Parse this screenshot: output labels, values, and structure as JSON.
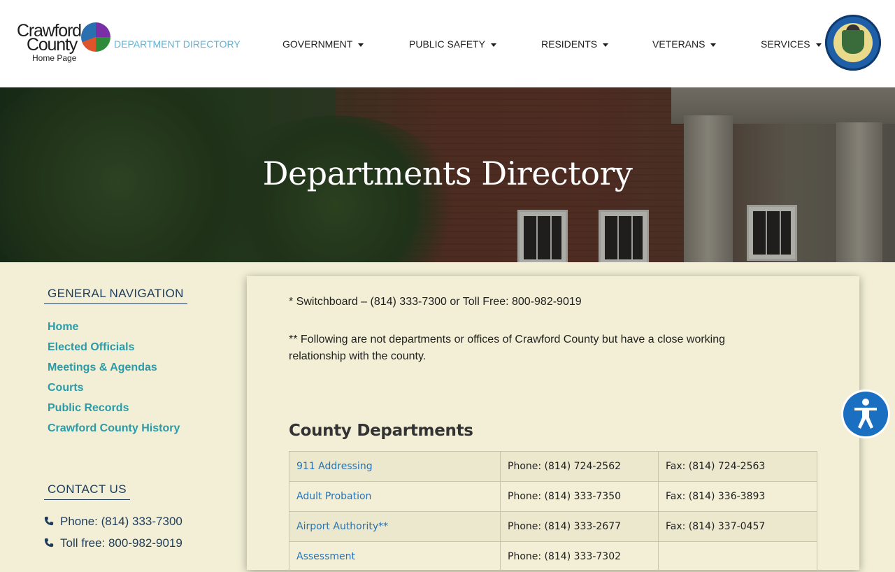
{
  "header": {
    "logo": {
      "line1": "Crawford",
      "line2": "County",
      "line3": "Home Page"
    },
    "nav": [
      {
        "label": "DEPARTMENT DIRECTORY",
        "active": true,
        "dropdown": false
      },
      {
        "label": "GOVERNMENT",
        "active": false,
        "dropdown": true
      },
      {
        "label": "PUBLIC SAFETY",
        "active": false,
        "dropdown": true
      },
      {
        "label": "RESIDENTS",
        "active": false,
        "dropdown": true
      },
      {
        "label": "VETERANS",
        "active": false,
        "dropdown": true
      },
      {
        "label": "SERVICES",
        "active": false,
        "dropdown": true
      }
    ],
    "seal_icon": "county-seal-icon"
  },
  "hero": {
    "title": "Departments Directory"
  },
  "sidebar": {
    "general_heading": "GENERAL NAVIGATION",
    "links": [
      "Home",
      "Elected Officials",
      "Meetings & Agendas",
      "Courts",
      "Public Records",
      "Crawford County History"
    ],
    "contact_heading": "CONTACT US",
    "contacts": [
      "Phone: (814) 333-7300",
      "Toll free: 800-982-9019"
    ]
  },
  "main": {
    "switchboard_note": "* Switchboard – (814) 333-7300 or Toll Free: 800-982-9019",
    "affiliates_note": "** Following are not departments or offices of Crawford County but have a close working relationship with the county.",
    "section_title": "County Departments",
    "rows": [
      {
        "name": "911 Addressing",
        "phone": "Phone: (814) 724-2562",
        "fax": "Fax: (814) 724-2563"
      },
      {
        "name": "Adult Probation",
        "phone": "Phone: (814) 333-7350",
        "fax": "Fax: (814) 336-3893"
      },
      {
        "name": "Airport Authority**",
        "phone": "Phone: (814) 333-2677",
        "fax": "Fax: (814) 337-0457"
      },
      {
        "name": "Assessment",
        "phone": "Phone: (814) 333-7302",
        "fax": ""
      }
    ]
  },
  "colors": {
    "accent": "#2a9ba8",
    "nav_active": "#5fb3d6",
    "link": "#2672b5",
    "background": "#f2efd6",
    "a11y_button": "#1a6fc0"
  },
  "accessibility": {
    "icon": "accessibility-icon"
  }
}
